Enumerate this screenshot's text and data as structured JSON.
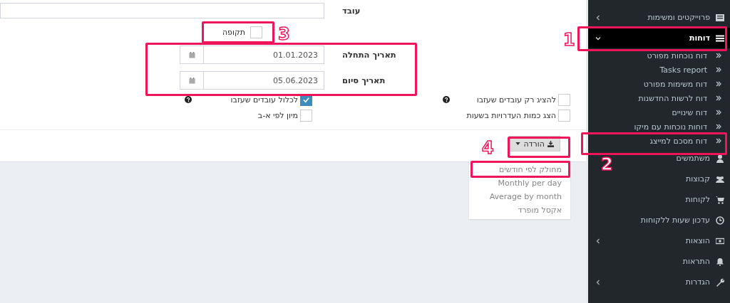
{
  "form": {
    "employee": {
      "label": "עובד"
    },
    "period": {
      "label": "תקופה",
      "checked": false
    },
    "start_date": {
      "label": "תאריך התחלה",
      "value": "01.01.2023"
    },
    "end_date": {
      "label": "תאריך סיום",
      "value": "05.06.2023"
    },
    "options": [
      {
        "label": "להציג רק עובדים שעזבו",
        "checked": false,
        "help": true
      },
      {
        "label": "לכלול עובדים שעזבו",
        "checked": true,
        "help": true
      },
      {
        "label": "הצג כמות העדרויות בשעות",
        "checked": false,
        "help": false
      },
      {
        "label": "מיון לפי א-ב",
        "checked": false,
        "help": false
      }
    ]
  },
  "download": {
    "label": "הורדה",
    "expanded": true,
    "items": [
      {
        "label": "מחולק לפי חודשים"
      },
      {
        "label": "Monthly per day"
      },
      {
        "label": "Average by month"
      },
      {
        "label": "אקסל מופרד"
      }
    ]
  },
  "sidebar": {
    "items": [
      {
        "label": "פרוייקטים ומשימות",
        "selected": false,
        "has_submenu": true,
        "expanded": false
      },
      {
        "label": "דוחות",
        "selected": true,
        "has_submenu": true,
        "expanded": true,
        "children": [
          {
            "label": "דוח נוכחות מפורט"
          },
          {
            "label": "Tasks report"
          },
          {
            "label": "דוח משימות מפורט"
          },
          {
            "label": "דוח לרשות החדשנות"
          },
          {
            "label": "דוח שינויים"
          },
          {
            "label": "דוחות נוכחות עם מיקו"
          },
          {
            "label": "דוח מסכם למייצג"
          }
        ]
      },
      {
        "label": "משתמשים",
        "selected": false,
        "has_submenu": false
      },
      {
        "label": "קבוצות",
        "selected": false,
        "has_submenu": false
      },
      {
        "label": "לקוחות",
        "selected": false,
        "has_submenu": false
      },
      {
        "label": "עדכון שעות ללקוחות",
        "selected": false,
        "has_submenu": false
      },
      {
        "label": "הוצאות",
        "selected": false,
        "has_submenu": true,
        "expanded": false
      },
      {
        "label": "התראות",
        "selected": false,
        "has_submenu": false
      },
      {
        "label": "הגדרות",
        "selected": false,
        "has_submenu": true,
        "expanded": false
      }
    ]
  },
  "annotations": [
    {
      "label": "1"
    },
    {
      "label": "2"
    },
    {
      "label": "3"
    },
    {
      "label": "4"
    }
  ]
}
